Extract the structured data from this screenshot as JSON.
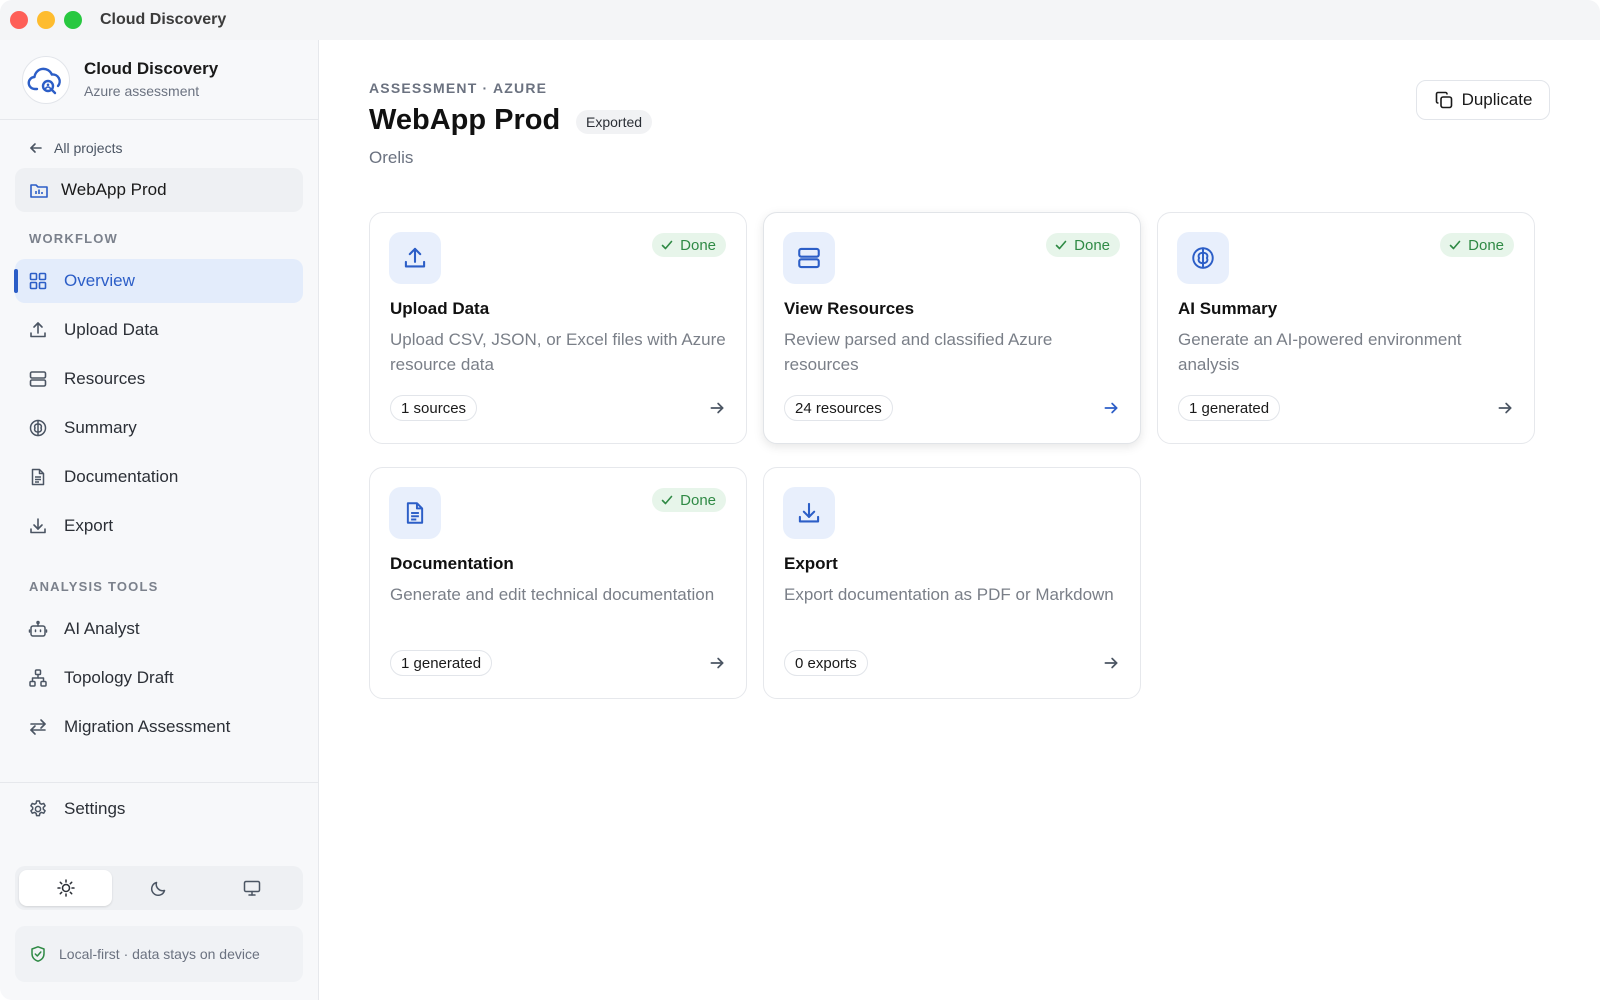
{
  "window": {
    "title": "Cloud Discovery"
  },
  "brand": {
    "name": "Cloud Discovery",
    "subtitle": "Azure assessment"
  },
  "sidebar": {
    "back_label": "All projects",
    "project_name": "WebApp Prod",
    "workflow_heading": "WORKFLOW",
    "workflow_items": [
      {
        "label": "Overview",
        "icon": "grid-icon",
        "active": true
      },
      {
        "label": "Upload Data",
        "icon": "upload-icon"
      },
      {
        "label": "Resources",
        "icon": "server-icon"
      },
      {
        "label": "Summary",
        "icon": "brain-icon"
      },
      {
        "label": "Documentation",
        "icon": "document-icon"
      },
      {
        "label": "Export",
        "icon": "download-icon"
      }
    ],
    "tools_heading": "ANALYSIS TOOLS",
    "tool_items": [
      {
        "label": "AI Analyst",
        "icon": "bot-icon"
      },
      {
        "label": "Topology Draft",
        "icon": "network-icon"
      },
      {
        "label": "Migration Assessment",
        "icon": "swap-icon"
      }
    ],
    "settings_label": "Settings",
    "theme_options": [
      "sun-icon",
      "moon-icon",
      "monitor-icon"
    ],
    "theme_selected": "sun-icon",
    "local_note": "Local-first · data stays on device"
  },
  "header": {
    "eyebrow": "ASSESSMENT · AZURE",
    "title": "WebApp Prod",
    "status": "Exported",
    "org": "Orelis",
    "duplicate_label": "Duplicate"
  },
  "cards": [
    {
      "title": "Upload Data",
      "description": "Upload CSV, JSON, or Excel files with Azure resource data",
      "count": "1 sources",
      "badge": "Done",
      "icon": "upload-icon"
    },
    {
      "title": "View Resources",
      "description": "Review parsed and classified Azure resources",
      "count": "24 resources",
      "badge": "Done",
      "icon": "server-icon"
    },
    {
      "title": "AI Summary",
      "description": "Generate an AI-powered environment analysis",
      "count": "1 generated",
      "badge": "Done",
      "icon": "brain-icon"
    },
    {
      "title": "Documentation",
      "description": "Generate and edit technical documentation",
      "count": "1 generated",
      "badge": "Done",
      "icon": "document-icon"
    },
    {
      "title": "Export",
      "description": "Export documentation as PDF or Markdown",
      "count": "0 exports",
      "badge": "",
      "icon": "download-icon"
    }
  ],
  "colors": {
    "accent": "#2c5ec7",
    "done_bg": "#e7f5ea",
    "done_text": "#2f8a45"
  }
}
